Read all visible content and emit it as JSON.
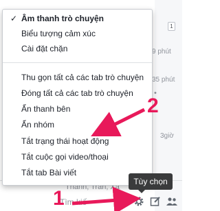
{
  "menu": {
    "items": [
      {
        "label": "Âm thanh trò chuyện",
        "checked": true
      },
      {
        "label": "Biểu tượng cảm xúc",
        "checked": false
      },
      {
        "label": "Cài đặt chặn",
        "checked": false
      },
      {
        "label": "Thu gọn tất cả các tab trò chuyện",
        "checked": false
      },
      {
        "label": "Đóng tất cả các tab trò chuyện",
        "checked": false
      },
      {
        "label": "Ẩn thanh bên",
        "checked": false
      },
      {
        "label": "Ẩn nhóm",
        "checked": false
      },
      {
        "label": "Tắt trạng thái hoạt động",
        "checked": false
      },
      {
        "label": "Tắt cuộc gọi video/thoại",
        "checked": false
      },
      {
        "label": "Tắt tab Bài viết",
        "checked": false
      }
    ],
    "check_glyph": "✓"
  },
  "background": {
    "badge": "1",
    "times": [
      "9 phút",
      "35 phút",
      "3giờ"
    ],
    "bottom_partial": "Thành, Trân, Xa"
  },
  "tooltip": {
    "label": "Tùy chọn"
  },
  "bottom_bar": {
    "search_placeholder": "Tìm kiế",
    "icons": [
      "gear-icon",
      "compose-icon",
      "people-icon"
    ]
  },
  "annotations": {
    "labels": [
      "1",
      "2"
    ],
    "color": "#e8195a"
  }
}
